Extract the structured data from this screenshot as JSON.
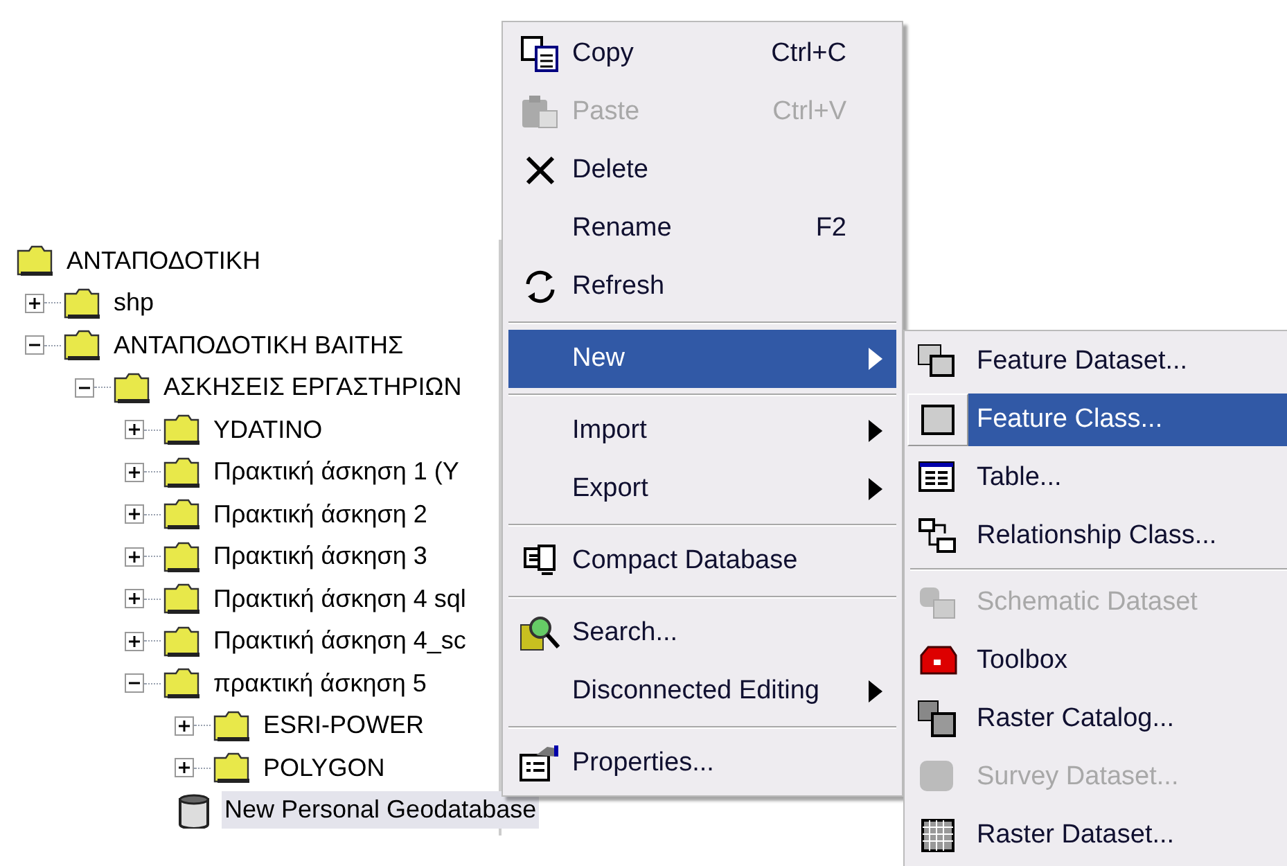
{
  "tree": [
    {
      "label": "ΑΝΤΑΠΟΔΟΤΙΚΗ",
      "kind": "folder",
      "children": [
        {
          "label": "shp",
          "kind": "folder",
          "expanded": false
        },
        {
          "label": "ΑΝΤΑΠΟΔΟΤΙΚΗ ΒΑΙΤΗΣ",
          "kind": "folder",
          "expanded": true,
          "children": [
            {
              "label": "ΑΣΚΗΣΕΙΣ ΕΡΓΑΣΤΗΡΙΩΝ",
              "kind": "folder",
              "expanded": true,
              "children": [
                {
                  "label": "YDATINO",
                  "kind": "folder",
                  "expanded": false
                },
                {
                  "label": "Πρακτική άσκηση 1 (Υ",
                  "kind": "folder",
                  "expanded": false
                },
                {
                  "label": "Πρακτική άσκηση 2",
                  "kind": "folder",
                  "expanded": false
                },
                {
                  "label": "Πρακτική άσκηση 3",
                  "kind": "folder",
                  "expanded": false
                },
                {
                  "label": "Πρακτική άσκηση 4 sql",
                  "kind": "folder",
                  "expanded": false
                },
                {
                  "label": "Πρακτική άσκηση 4_sc",
                  "kind": "folder",
                  "expanded": false
                },
                {
                  "label": "πρακτική άσκηση 5",
                  "kind": "folder",
                  "expanded": true,
                  "children": [
                    {
                      "label": "ESRI-POWER",
                      "kind": "folder",
                      "expanded": false
                    },
                    {
                      "label": "POLYGON",
                      "kind": "folder",
                      "expanded": false
                    },
                    {
                      "label": "New Personal Geodatabase",
                      "kind": "database",
                      "selected": true
                    }
                  ]
                }
              ]
            }
          ]
        }
      ]
    }
  ],
  "context_menu": [
    {
      "kind": "item",
      "label": "Copy",
      "shortcut": "Ctrl+C",
      "disabled": false,
      "selected": false
    },
    {
      "kind": "item",
      "label": "Paste",
      "shortcut": "Ctrl+V",
      "disabled": true,
      "selected": false
    },
    {
      "kind": "item",
      "label": "Delete",
      "disabled": false,
      "selected": false
    },
    {
      "kind": "item",
      "label": "Rename",
      "shortcut": "F2",
      "disabled": false,
      "selected": false
    },
    {
      "kind": "item",
      "label": "Refresh",
      "disabled": false,
      "selected": false
    },
    {
      "kind": "separator"
    },
    {
      "kind": "item",
      "label": "New",
      "submenu": true,
      "disabled": false,
      "selected": true
    },
    {
      "kind": "separator"
    },
    {
      "kind": "item",
      "label": "Import",
      "submenu": true,
      "disabled": false,
      "selected": false
    },
    {
      "kind": "item",
      "label": "Export",
      "submenu": true,
      "disabled": false,
      "selected": false
    },
    {
      "kind": "separator"
    },
    {
      "kind": "item",
      "label": "Compact Database",
      "disabled": false,
      "selected": false
    },
    {
      "kind": "separator"
    },
    {
      "kind": "item",
      "label": "Search...",
      "disabled": false,
      "selected": false
    },
    {
      "kind": "item",
      "label": "Disconnected Editing",
      "submenu": true,
      "disabled": false,
      "selected": false
    },
    {
      "kind": "separator"
    },
    {
      "kind": "item",
      "label": "Properties...",
      "disabled": false,
      "selected": false
    }
  ],
  "submenu": [
    {
      "kind": "item",
      "label": "Feature Dataset...",
      "disabled": false,
      "selected": false
    },
    {
      "kind": "item",
      "label": "Feature Class...",
      "disabled": false,
      "selected": true
    },
    {
      "kind": "item",
      "label": "Table...",
      "disabled": false,
      "selected": false
    },
    {
      "kind": "item",
      "label": "Relationship Class...",
      "disabled": false,
      "selected": false
    },
    {
      "kind": "separator"
    },
    {
      "kind": "item",
      "label": "Schematic Dataset",
      "disabled": true,
      "selected": false
    },
    {
      "kind": "item",
      "label": "Toolbox",
      "disabled": false,
      "selected": false
    },
    {
      "kind": "item",
      "label": "Raster Catalog...",
      "disabled": false,
      "selected": false
    },
    {
      "kind": "item",
      "label": "Survey Dataset...",
      "disabled": true,
      "selected": false
    },
    {
      "kind": "item",
      "label": "Raster Dataset...",
      "disabled": false,
      "selected": false
    }
  ]
}
